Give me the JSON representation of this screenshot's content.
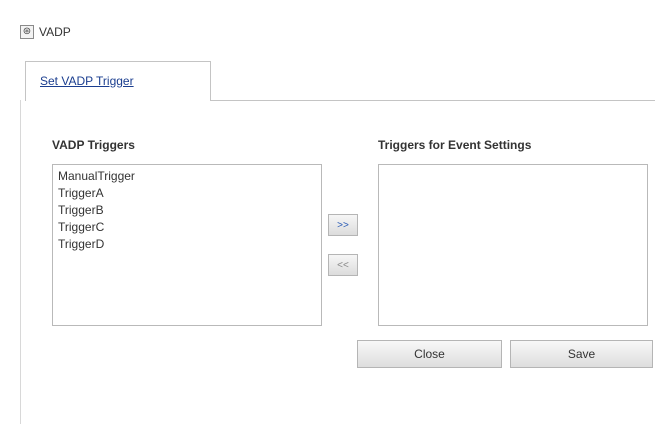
{
  "header": {
    "icon": "settings-icon",
    "icon_glyph": "⊛",
    "title": "VADP"
  },
  "tabs": [
    {
      "label": "Set VADP Trigger",
      "active": true
    }
  ],
  "left_list": {
    "label": "VADP Triggers",
    "items": [
      "ManualTrigger",
      "TriggerA",
      "TriggerB",
      "TriggerC",
      "TriggerD"
    ]
  },
  "right_list": {
    "label": "Triggers for Event Settings",
    "items": []
  },
  "move_buttons": {
    "add_label": ">>",
    "remove_label": "<<"
  },
  "actions": {
    "close_label": "Close",
    "save_label": "Save"
  },
  "colors": {
    "tab_link": "#1a3d8f",
    "move_add": "#2a5bb5"
  }
}
